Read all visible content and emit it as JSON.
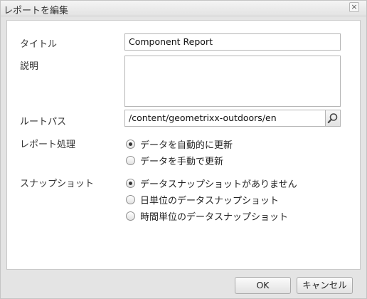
{
  "dialog": {
    "title": "レポートを編集",
    "close_label": "×"
  },
  "form": {
    "title_label": "タイトル",
    "title_value": "Component Report",
    "description_label": "説明",
    "description_value": "",
    "root_path_label": "ルートパス",
    "root_path_value": "/content/geometrixx-outdoors/en",
    "processing_label": "レポート処理",
    "processing_options": [
      {
        "label": "データを自動的に更新",
        "checked": true
      },
      {
        "label": "データを手動で更新",
        "checked": false
      }
    ],
    "snapshot_label": "スナップショット",
    "snapshot_options": [
      {
        "label": "データスナップショットがありません",
        "checked": true
      },
      {
        "label": "日単位のデータスナップショット",
        "checked": false
      },
      {
        "label": "時間単位のデータスナップショット",
        "checked": false
      }
    ]
  },
  "footer": {
    "ok_label": "OK",
    "cancel_label": "キャンセル"
  },
  "icons": {
    "search": "search-icon",
    "close": "close-icon"
  }
}
